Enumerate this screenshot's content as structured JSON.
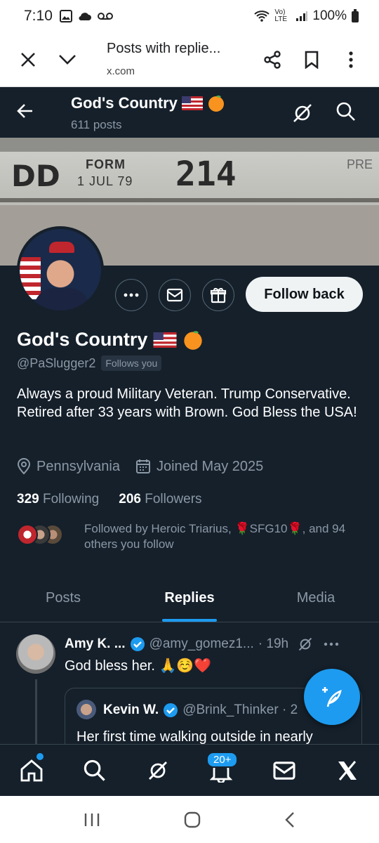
{
  "status_bar": {
    "time": "7:10",
    "network": "Vo) LTE",
    "battery": "100%"
  },
  "browser": {
    "title": "Posts with replie...",
    "url": "x.com"
  },
  "header": {
    "name": "God's Country",
    "posts": "611 posts"
  },
  "banner": {
    "dd": "DD",
    "form": "FORM",
    "date": "1 JUL 79",
    "number": "214",
    "prev": "PRE"
  },
  "profile": {
    "name": "God's Country",
    "handle": "@PaSlugger2",
    "follows_you": "Follows you",
    "follow_button": "Follow back",
    "bio": "Always a proud Military Veteran. Trump Conservative. Retired after 33 years with Brown. God Bless the USA!",
    "location": "Pennsylvania",
    "joined": "Joined May 2025",
    "following_count": "329",
    "following_label": "Following",
    "followers_count": "206",
    "followers_label": "Followers",
    "followed_by": "Followed by Heroic Triarius, 🌹SFG10🌹, and 94 others you follow"
  },
  "tabs": [
    {
      "label": "Posts",
      "active": false
    },
    {
      "label": "Replies",
      "active": true
    },
    {
      "label": "Media",
      "active": false
    }
  ],
  "post": {
    "author": "Amy K. ...",
    "handle": "@amy_gomez1...",
    "time": "· 19h",
    "text": "God bless her. 🙏☺️❤️",
    "quote": {
      "author": "Kevin W.",
      "handle": "@Brink_Thinker · 2",
      "text": "Her first time walking outside in nearly"
    }
  },
  "bottom_nav": {
    "notifications_badge": "20+"
  },
  "colors": {
    "background": "#15202b",
    "accent": "#1d9bf0",
    "muted": "#8b98a5",
    "border": "#38444d"
  }
}
